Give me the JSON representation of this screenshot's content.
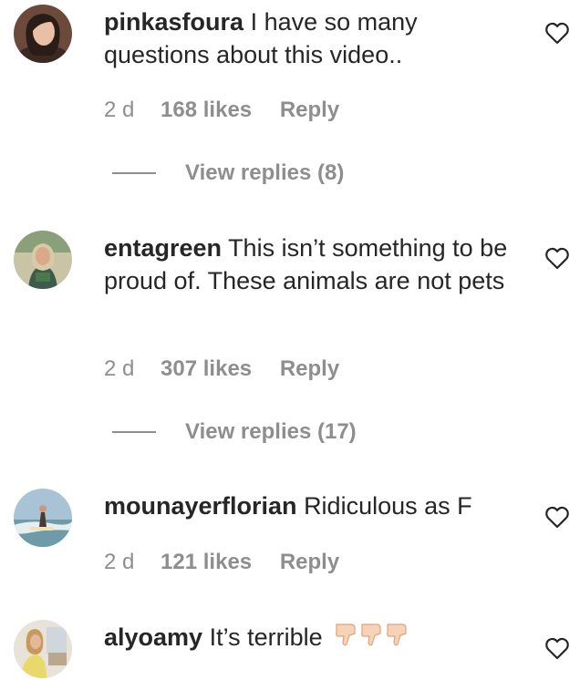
{
  "comments": [
    {
      "username": "pinkasfoura",
      "text": "I have so many questions about this video..",
      "age": "2 d",
      "likes": "168 likes",
      "reply_label": "Reply",
      "view_replies": "View replies (8)"
    },
    {
      "username": "entagreen",
      "text": "This isn’t something to be proud of. These animals are not pets",
      "age": "2 d",
      "likes": "307 likes",
      "reply_label": "Reply",
      "view_replies": "View replies (17)"
    },
    {
      "username": "mounayerflorian",
      "text": "Ridiculous as F",
      "age": "2 d",
      "likes": "121 likes",
      "reply_label": "Reply"
    },
    {
      "username": "alyoamy",
      "text": "It’s terrible",
      "emoji": "👎🏻👎🏻👎🏻"
    }
  ],
  "colors": {
    "text": "#262626",
    "secondary": "#8e8e8e"
  },
  "icons": {
    "like": "heart-outline-icon",
    "dislike_emoji": "thumbs-down-light-skin-tone"
  }
}
